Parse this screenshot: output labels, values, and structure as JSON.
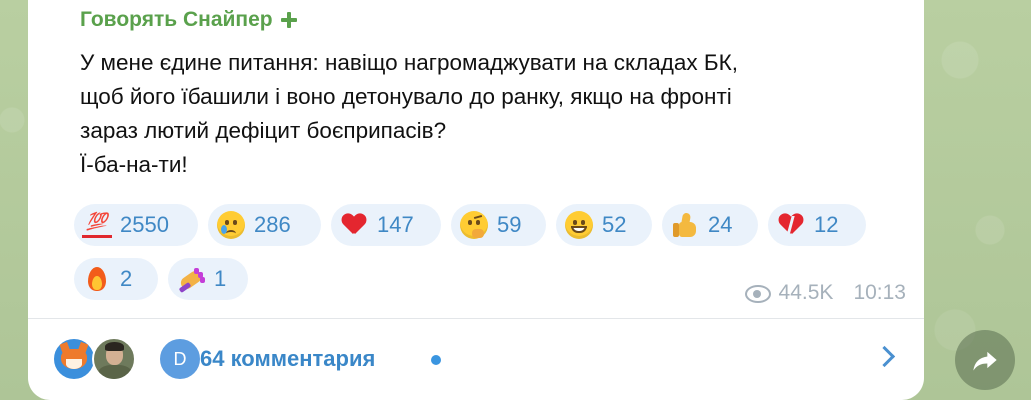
{
  "post": {
    "sender": "Говорять Снайпер",
    "lines": [
      "У мене єдине питання: навіщо нагромаджувати на складах БК,",
      "щоб його їбашили і воно детонувало до ранку, якщо на фронті",
      "зараз лютий дефіцит боєприпасів?",
      "Ї-ба-на-ти!"
    ],
    "views": "44.5K",
    "time": "10:13"
  },
  "reactions": [
    {
      "icon": "hundred-points-emoji",
      "label": "💯",
      "count": "2550"
    },
    {
      "icon": "crying-face-emoji",
      "count": "286"
    },
    {
      "icon": "red-heart-emoji",
      "count": "147"
    },
    {
      "icon": "thinking-face-emoji",
      "count": "59"
    },
    {
      "icon": "grinning-face-emoji",
      "count": "52"
    },
    {
      "icon": "thumbs-up-emoji",
      "count": "24"
    },
    {
      "icon": "broken-heart-emoji",
      "count": "12"
    },
    {
      "icon": "fire-emoji",
      "count": "2"
    },
    {
      "icon": "nail-polish-emoji",
      "count": "1"
    }
  ],
  "comments": {
    "label": "64 комментария",
    "avatar_letter": "D"
  },
  "colors": {
    "sender": "#5aa14c",
    "link": "#3a87c8",
    "reaction_bg": "#eaf2fb",
    "meta": "#a6b1bb"
  }
}
